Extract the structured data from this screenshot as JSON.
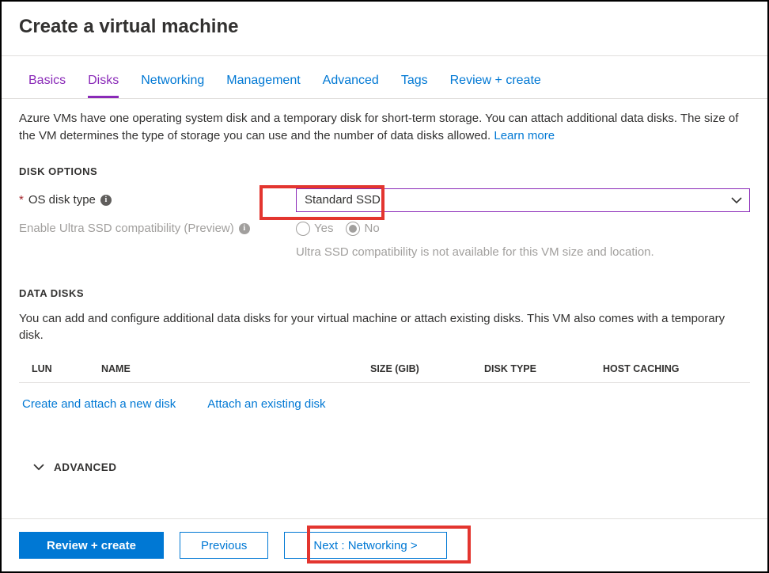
{
  "header": {
    "title": "Create a virtual machine"
  },
  "tabs": [
    {
      "label": "Basics"
    },
    {
      "label": "Disks"
    },
    {
      "label": "Networking"
    },
    {
      "label": "Management"
    },
    {
      "label": "Advanced"
    },
    {
      "label": "Tags"
    },
    {
      "label": "Review + create"
    }
  ],
  "description": {
    "text": "Azure VMs have one operating system disk and a temporary disk for short-term storage. You can attach additional data disks. The size of the VM determines the type of storage you can use and the number of data disks allowed.  ",
    "learn_more": "Learn more"
  },
  "sections": {
    "disk_options_title": "DISK OPTIONS",
    "os_disk_type_label": "OS disk type",
    "os_disk_type_value": "Standard SSD",
    "ultra_ssd_label": "Enable Ultra SSD compatibility (Preview)",
    "ultra_ssd_yes": "Yes",
    "ultra_ssd_no": "No",
    "ultra_ssd_helper": "Ultra SSD compatibility is not available for this VM size and location.",
    "data_disks_title": "DATA DISKS",
    "data_disks_desc": "You can add and configure additional data disks for your virtual machine or attach existing disks. This VM also comes with a temporary disk.",
    "columns": {
      "lun": "LUN",
      "name": "NAME",
      "size": "SIZE (GIB)",
      "type": "DISK TYPE",
      "caching": "HOST CACHING"
    },
    "create_link": "Create and attach a new disk",
    "attach_link": "Attach an existing disk",
    "advanced_title": "ADVANCED"
  },
  "footer": {
    "review": "Review + create",
    "previous": "Previous",
    "next": "Next : Networking >"
  }
}
